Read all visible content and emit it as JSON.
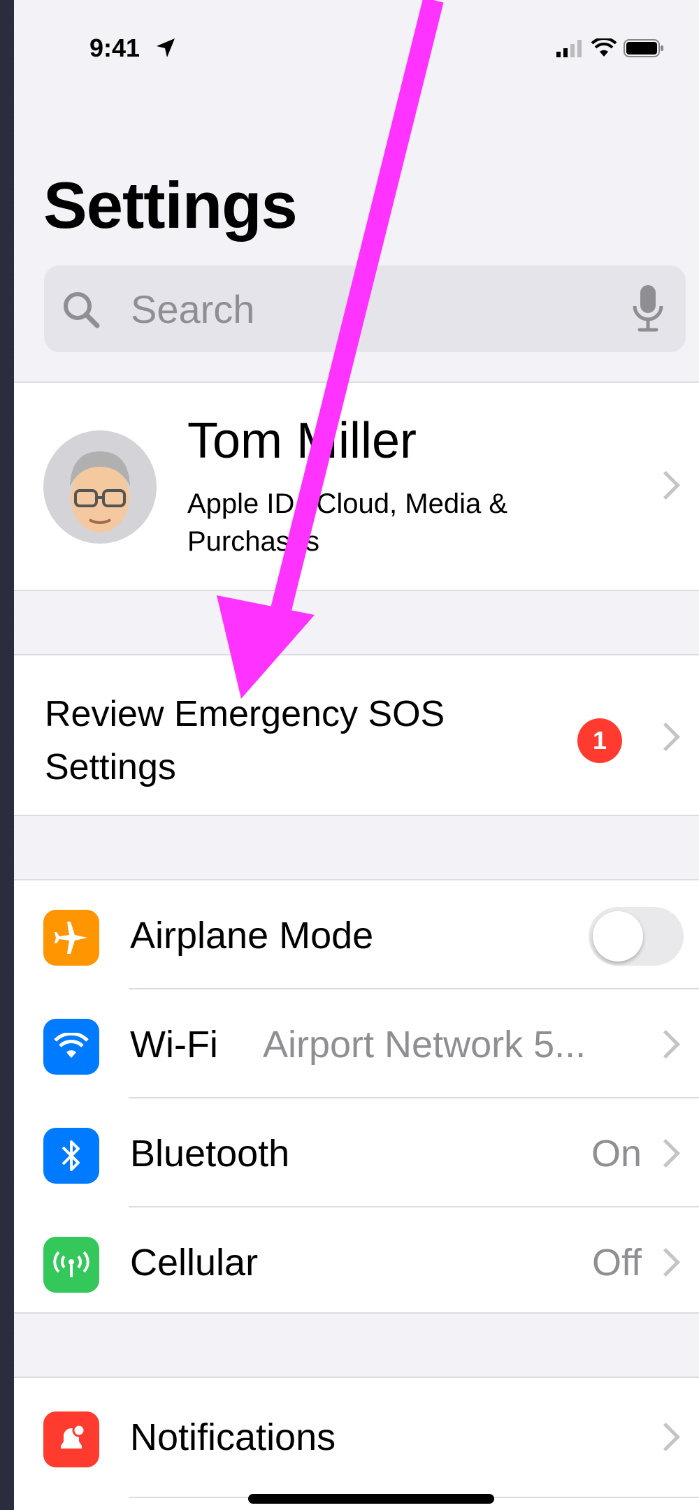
{
  "status_bar": {
    "time": "9:41"
  },
  "page": {
    "title": "Settings"
  },
  "search": {
    "placeholder": "Search"
  },
  "profile": {
    "name": "Tom Miller",
    "subtitle": "Apple ID, iCloud, Media & Purchases"
  },
  "suggestion": {
    "label": "Review Emergency SOS Settings",
    "badge_count": "1"
  },
  "connectivity": [
    {
      "label": "Airplane Mode",
      "value": "",
      "icon": "airplane-icon",
      "icon_color": "#ff9500",
      "toggle_on": false
    },
    {
      "label": "Wi-Fi",
      "value": "Airport Network 5...",
      "icon": "wifi-icon",
      "icon_color": "#007aff"
    },
    {
      "label": "Bluetooth",
      "value": "On",
      "icon": "bluetooth-icon",
      "icon_color": "#007aff"
    },
    {
      "label": "Cellular",
      "value": "Off",
      "icon": "cellular-icon",
      "icon_color": "#34c759"
    }
  ],
  "notifications": {
    "label": "Notifications",
    "icon": "notifications-icon",
    "icon_color": "#ff3b30"
  },
  "colors": {
    "annotation_arrow": "#ff33ff",
    "badge": "#ff3b30"
  }
}
